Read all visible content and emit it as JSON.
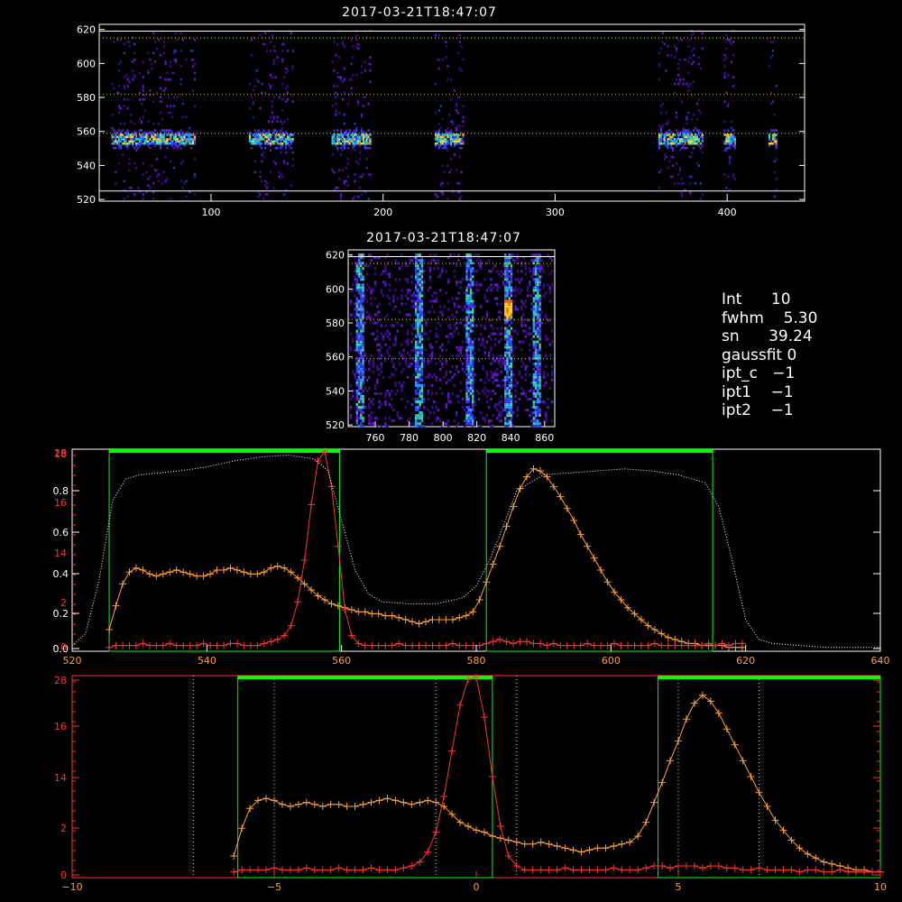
{
  "colors": {
    "background": "#000000",
    "axis": "#ffffff",
    "orange_series": "#ffa030",
    "red_series": "#ff3030",
    "green_boxes": "#00ff00",
    "dotted_profile": "#ffffff",
    "guide_lines": "#d4c840"
  },
  "params": [
    {
      "label": "Int",
      "value": "10"
    },
    {
      "label": "fwhm",
      "value": "5.30"
    },
    {
      "label": "sn",
      "value": "39.24"
    },
    {
      "label": "gaussfit",
      "value": "0"
    },
    {
      "label": "ipt_c",
      "value": "−1"
    },
    {
      "label": "ipt1",
      "value": "−1"
    },
    {
      "label": "ipt2",
      "value": "−1"
    }
  ],
  "chart_data": [
    {
      "type": "heatmap",
      "title": "2017-03-21T18:47:07",
      "xlabel": "",
      "ylabel": "",
      "xlim": [
        35,
        445
      ],
      "ylim": [
        519,
        623
      ],
      "xticks": [
        100,
        200,
        300,
        400
      ],
      "yticks": [
        520,
        540,
        560,
        580,
        600,
        620
      ],
      "bright_row_y": 556,
      "active_column_ranges": [
        [
          42,
          90
        ],
        [
          122,
          147
        ],
        [
          170,
          192
        ],
        [
          230,
          246
        ],
        [
          360,
          385
        ],
        [
          398,
          404
        ],
        [
          424,
          428
        ]
      ],
      "horizontal_guides_y": [
        525,
        559,
        582,
        615,
        619
      ]
    },
    {
      "type": "heatmap",
      "title": "2017-03-21T18:47:07",
      "xlabel": "",
      "ylabel": "",
      "xlim": [
        744,
        866
      ],
      "ylim": [
        519,
        623
      ],
      "xticks": [
        760,
        780,
        800,
        820,
        840,
        860
      ],
      "yticks": [
        520,
        540,
        560,
        580,
        600,
        620
      ],
      "bright_columns_x": [
        750,
        785,
        815,
        838,
        855
      ],
      "peak": {
        "x": 838,
        "y": 589
      },
      "horizontal_guides_y": [
        559,
        582,
        615,
        619
      ]
    },
    {
      "type": "line",
      "title": "",
      "xlabel": "",
      "ylabel": "",
      "xlim": [
        520,
        640
      ],
      "xticks": [
        520,
        540,
        560,
        580,
        600,
        620,
        640
      ],
      "left_yticks_white": [
        "0.0",
        "0.2",
        "0.4",
        "0.6",
        "0.8"
      ],
      "left_yticks_red": [
        "0",
        "2",
        "14",
        "16",
        "18",
        "28"
      ],
      "ylim": [
        0,
        1.0
      ],
      "green_boxes": [
        {
          "x0": 525.5,
          "x1": 559.7
        },
        {
          "x0": 581.5,
          "x1": 615.1
        }
      ],
      "series": [
        {
          "name": "",
          "color": "orange",
          "x": [
            525.5,
            526.5,
            527.5,
            528.5,
            529.5,
            530.5,
            531.5,
            532.5,
            533.5,
            534.5,
            535.5,
            536.5,
            537.5,
            538.5,
            539.5,
            540.5,
            541.5,
            542.5,
            543.5,
            544.5,
            545.5,
            546.5,
            547.5,
            548.5,
            549.5,
            550.5,
            551.5,
            552.5,
            553.5,
            554.5,
            555.5,
            556.5,
            557.5,
            558.5,
            559.5,
            560.5,
            561.5,
            562.5,
            563.5,
            564.5,
            565.5,
            566.5,
            567.5,
            568.5,
            569.5,
            570.5,
            571.5,
            572.5,
            573.5,
            574.5,
            575.5,
            576.5,
            577.5,
            578.5,
            579.5,
            580.5,
            581.5,
            582.5,
            583.5,
            584.5,
            585.5,
            586.5,
            587.5,
            588.5,
            589.5,
            590.5,
            591.5,
            592.5,
            593.5,
            594.5,
            595.5,
            596.5,
            597.5,
            598.5,
            599.5,
            600.5,
            601.5,
            602.5,
            603.5,
            604.5,
            605.5,
            606.5,
            607.5,
            608.5,
            609.5,
            610.5,
            611.5,
            612.5,
            613.5,
            614.5,
            615.5,
            616.5,
            617.5,
            618.5,
            619.5
          ],
          "y": [
            0.1,
            0.22,
            0.33,
            0.39,
            0.41,
            0.4,
            0.38,
            0.37,
            0.38,
            0.39,
            0.4,
            0.39,
            0.38,
            0.37,
            0.37,
            0.38,
            0.4,
            0.4,
            0.41,
            0.4,
            0.39,
            0.38,
            0.38,
            0.39,
            0.41,
            0.42,
            0.41,
            0.39,
            0.36,
            0.33,
            0.3,
            0.27,
            0.25,
            0.23,
            0.22,
            0.21,
            0.2,
            0.19,
            0.19,
            0.18,
            0.18,
            0.17,
            0.17,
            0.16,
            0.15,
            0.14,
            0.13,
            0.14,
            0.15,
            0.15,
            0.15,
            0.15,
            0.16,
            0.17,
            0.19,
            0.25,
            0.34,
            0.43,
            0.52,
            0.62,
            0.72,
            0.81,
            0.87,
            0.91,
            0.9,
            0.87,
            0.82,
            0.77,
            0.71,
            0.65,
            0.58,
            0.52,
            0.46,
            0.4,
            0.34,
            0.29,
            0.25,
            0.21,
            0.18,
            0.15,
            0.12,
            0.1,
            0.08,
            0.06,
            0.05,
            0.04,
            0.03,
            0.03,
            0.02,
            0.02,
            0.02,
            0.02,
            0.01,
            0.01,
            0.01
          ]
        },
        {
          "name": "",
          "color": "red",
          "x": [
            525.5,
            526.5,
            527.5,
            528.5,
            529.5,
            530.5,
            531.5,
            532.5,
            533.5,
            534.5,
            535.5,
            536.5,
            537.5,
            538.5,
            539.5,
            540.5,
            541.5,
            542.5,
            543.5,
            544.5,
            545.5,
            546.5,
            547.5,
            548.5,
            549.5,
            550.5,
            551.5,
            552.5,
            553.5,
            554.5,
            555.5,
            556.5,
            557.5,
            558.5,
            559.5,
            560.5,
            561.5,
            562.5,
            563.5,
            564.5,
            565.5,
            566.5,
            567.5,
            568.5,
            569.5,
            570.5,
            571.5,
            572.5,
            573.5,
            574.5,
            575.5,
            576.5,
            577.5,
            578.5,
            579.5,
            580.5,
            581.5,
            582.5,
            583.5,
            584.5,
            585.5,
            586.5,
            587.5,
            588.5,
            589.5,
            590.5,
            591.5,
            592.5,
            593.5,
            594.5,
            595.5,
            596.5,
            597.5,
            598.5,
            599.5,
            600.5,
            601.5,
            602.5,
            603.5,
            604.5,
            605.5,
            606.5,
            607.5,
            608.5,
            609.5,
            610.5,
            611.5,
            612.5,
            613.5,
            614.5,
            615.5,
            616.5,
            617.5,
            618.5,
            619.5
          ],
          "y": [
            0.01,
            0.02,
            0.02,
            0.02,
            0.02,
            0.03,
            0.02,
            0.02,
            0.02,
            0.03,
            0.02,
            0.02,
            0.02,
            0.02,
            0.03,
            0.02,
            0.02,
            0.02,
            0.03,
            0.03,
            0.02,
            0.02,
            0.02,
            0.03,
            0.04,
            0.05,
            0.07,
            0.12,
            0.24,
            0.45,
            0.73,
            0.95,
            1.0,
            0.82,
            0.52,
            0.2,
            0.07,
            0.03,
            0.02,
            0.02,
            0.02,
            0.02,
            0.02,
            0.03,
            0.02,
            0.02,
            0.02,
            0.02,
            0.02,
            0.02,
            0.02,
            0.03,
            0.02,
            0.02,
            0.02,
            0.02,
            0.03,
            0.04,
            0.05,
            0.04,
            0.03,
            0.04,
            0.04,
            0.03,
            0.03,
            0.02,
            0.03,
            0.02,
            0.02,
            0.02,
            0.02,
            0.03,
            0.02,
            0.02,
            0.02,
            0.03,
            0.02,
            0.02,
            0.02,
            0.02,
            0.02,
            0.03,
            0.02,
            0.02,
            0.02,
            0.02,
            0.02,
            0.02,
            0.02,
            0.03,
            0.02,
            0.03,
            0.02,
            0.03,
            0.03
          ]
        },
        {
          "name": "",
          "color": "white-dotted",
          "x": [
            520,
            522,
            524,
            526,
            528,
            530,
            533,
            536,
            540,
            544,
            548,
            552,
            556,
            558,
            560,
            562,
            564,
            566,
            570,
            574,
            578,
            580,
            582,
            584,
            586,
            590,
            594,
            598,
            602,
            606,
            610,
            614,
            616,
            618,
            620,
            622,
            624,
            628,
            632,
            636,
            640
          ],
          "y": [
            0.02,
            0.08,
            0.35,
            0.75,
            0.86,
            0.88,
            0.89,
            0.9,
            0.92,
            0.95,
            0.97,
            0.98,
            0.96,
            0.9,
            0.65,
            0.4,
            0.28,
            0.24,
            0.23,
            0.23,
            0.26,
            0.32,
            0.45,
            0.62,
            0.8,
            0.88,
            0.89,
            0.9,
            0.91,
            0.9,
            0.88,
            0.84,
            0.72,
            0.45,
            0.15,
            0.05,
            0.03,
            0.02,
            0.01,
            0.01,
            0.01
          ]
        }
      ]
    },
    {
      "type": "line",
      "title": "",
      "xlabel": "",
      "ylabel": "",
      "xlim": [
        -10,
        10
      ],
      "xticks": [
        -10,
        -5,
        0,
        5,
        10
      ],
      "left_yticks_red": [
        "0",
        "2",
        "14",
        "16",
        "28"
      ],
      "ylim": [
        0,
        1.0
      ],
      "green_boxes": [
        {
          "x0": -5.9,
          "x1": 0.4
        },
        {
          "x0": 4.5,
          "x1": 10
        }
      ],
      "vertical_guides": [
        -7,
        -5,
        -1,
        1,
        5,
        7
      ],
      "series": [
        {
          "name": "",
          "color": "orange",
          "x": [
            -6.0,
            -5.8,
            -5.6,
            -5.4,
            -5.2,
            -5.0,
            -4.8,
            -4.6,
            -4.4,
            -4.2,
            -4.0,
            -3.8,
            -3.6,
            -3.4,
            -3.2,
            -3.0,
            -2.8,
            -2.6,
            -2.4,
            -2.2,
            -2.0,
            -1.8,
            -1.6,
            -1.4,
            -1.2,
            -1.0,
            -0.8,
            -0.6,
            -0.4,
            -0.2,
            0.0,
            0.2,
            0.4,
            0.6,
            0.8,
            1.0,
            1.2,
            1.4,
            1.6,
            1.8,
            2.0,
            2.2,
            2.4,
            2.6,
            2.8,
            3.0,
            3.2,
            3.4,
            3.6,
            3.8,
            4.0,
            4.2,
            4.4,
            4.6,
            4.8,
            5.0,
            5.2,
            5.4,
            5.6,
            5.8,
            6.0,
            6.2,
            6.4,
            6.6,
            6.8,
            7.0,
            7.2,
            7.4,
            7.6,
            7.8,
            8.0,
            8.2,
            8.4,
            8.6,
            8.8,
            9.0,
            9.2,
            9.4,
            9.6,
            9.8,
            10.0
          ],
          "y": [
            0.1,
            0.24,
            0.34,
            0.38,
            0.39,
            0.38,
            0.36,
            0.35,
            0.36,
            0.37,
            0.36,
            0.35,
            0.36,
            0.36,
            0.35,
            0.35,
            0.36,
            0.37,
            0.38,
            0.39,
            0.38,
            0.37,
            0.36,
            0.37,
            0.38,
            0.37,
            0.35,
            0.31,
            0.27,
            0.25,
            0.23,
            0.22,
            0.2,
            0.19,
            0.18,
            0.17,
            0.16,
            0.16,
            0.17,
            0.16,
            0.15,
            0.14,
            0.13,
            0.12,
            0.13,
            0.14,
            0.14,
            0.15,
            0.16,
            0.17,
            0.2,
            0.27,
            0.37,
            0.47,
            0.58,
            0.68,
            0.79,
            0.87,
            0.91,
            0.88,
            0.82,
            0.74,
            0.66,
            0.58,
            0.5,
            0.42,
            0.35,
            0.28,
            0.23,
            0.18,
            0.14,
            0.11,
            0.09,
            0.07,
            0.06,
            0.05,
            0.04,
            0.03,
            0.03,
            0.02,
            0.02
          ]
        },
        {
          "name": "",
          "color": "red",
          "x": [
            -6.0,
            -5.8,
            -5.6,
            -5.4,
            -5.2,
            -5.0,
            -4.8,
            -4.6,
            -4.4,
            -4.2,
            -4.0,
            -3.8,
            -3.6,
            -3.4,
            -3.2,
            -3.0,
            -2.8,
            -2.6,
            -2.4,
            -2.2,
            -2.0,
            -1.8,
            -1.6,
            -1.4,
            -1.2,
            -1.0,
            -0.8,
            -0.6,
            -0.4,
            -0.2,
            0.0,
            0.2,
            0.4,
            0.6,
            0.8,
            1.0,
            1.2,
            1.4,
            1.6,
            1.8,
            2.0,
            2.2,
            2.4,
            2.6,
            2.8,
            3.0,
            3.2,
            3.4,
            3.6,
            3.8,
            4.0,
            4.2,
            4.4,
            4.6,
            4.8,
            5.0,
            5.2,
            5.4,
            5.6,
            5.8,
            6.0,
            6.2,
            6.4,
            6.6,
            6.8,
            7.0,
            7.2,
            7.4,
            7.6,
            7.8,
            8.0,
            8.2,
            8.4,
            8.6,
            8.8,
            9.0,
            9.2,
            9.4,
            9.6,
            9.8,
            10.0
          ],
          "y": [
            0.02,
            0.03,
            0.03,
            0.03,
            0.03,
            0.04,
            0.03,
            0.03,
            0.03,
            0.04,
            0.03,
            0.03,
            0.03,
            0.04,
            0.03,
            0.03,
            0.03,
            0.04,
            0.03,
            0.03,
            0.03,
            0.04,
            0.05,
            0.07,
            0.12,
            0.22,
            0.4,
            0.63,
            0.86,
            0.99,
            1.0,
            0.8,
            0.5,
            0.25,
            0.1,
            0.05,
            0.03,
            0.03,
            0.03,
            0.03,
            0.03,
            0.04,
            0.03,
            0.03,
            0.03,
            0.03,
            0.03,
            0.04,
            0.03,
            0.03,
            0.03,
            0.04,
            0.05,
            0.05,
            0.04,
            0.05,
            0.05,
            0.05,
            0.04,
            0.05,
            0.05,
            0.04,
            0.04,
            0.03,
            0.03,
            0.04,
            0.03,
            0.03,
            0.03,
            0.03,
            0.02,
            0.03,
            0.03,
            0.02,
            0.02,
            0.03,
            0.02,
            0.02,
            0.02,
            0.02,
            0.02
          ]
        }
      ]
    }
  ]
}
